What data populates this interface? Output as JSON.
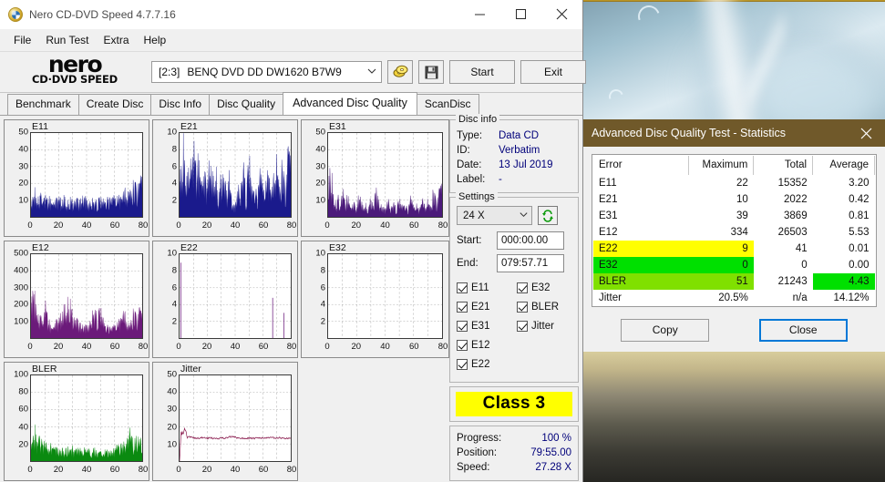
{
  "window": {
    "title": "Nero CD-DVD Speed 4.7.7.16",
    "icon": "nero-disc-icon",
    "minimize": "minimize-icon",
    "maximize": "maximize-icon",
    "close": "close-icon"
  },
  "menu": {
    "items": [
      "File",
      "Run Test",
      "Extra",
      "Help"
    ]
  },
  "toolbar": {
    "logo_word": "nero",
    "logo_sub": "CD·DVD SPEED",
    "drive_bracket": "[2:3]",
    "drive_name": "BENQ DVD DD DW1620 B7W9",
    "speed_icon": "disc-speed-icon",
    "save_icon": "floppy-save-icon",
    "start_label": "Start",
    "exit_label": "Exit"
  },
  "tabs": {
    "items": [
      "Benchmark",
      "Create Disc",
      "Disc Info",
      "Disc Quality",
      "Advanced Disc Quality",
      "ScanDisc"
    ],
    "active": "Advanced Disc Quality"
  },
  "disc_info": {
    "title": "Disc info",
    "rows": [
      {
        "label": "Type:",
        "value": "Data CD"
      },
      {
        "label": "ID:",
        "value": "Verbatim"
      },
      {
        "label": "Date:",
        "value": "13 Jul 2019"
      },
      {
        "label": "Label:",
        "value": "-"
      }
    ]
  },
  "settings": {
    "title": "Settings",
    "speed": "24 X",
    "refresh_icon": "refresh-icon",
    "start_label": "Start:",
    "start_value": "000:00.00",
    "end_label": "End:",
    "end_value": "079:57.71",
    "checkboxes_left": [
      {
        "label": "E11",
        "checked": true
      },
      {
        "label": "E21",
        "checked": true
      },
      {
        "label": "E31",
        "checked": true
      },
      {
        "label": "E12",
        "checked": true
      },
      {
        "label": "E22",
        "checked": true
      }
    ],
    "checkboxes_right": [
      {
        "label": "E32",
        "checked": true
      },
      {
        "label": "BLER",
        "checked": true
      },
      {
        "label": "Jitter",
        "checked": true
      }
    ]
  },
  "class_result": {
    "label": "Class 3",
    "background": "#ffff00"
  },
  "progress": {
    "rows": [
      {
        "label": "Progress:",
        "value": "100 %"
      },
      {
        "label": "Position:",
        "value": "79:55.00"
      },
      {
        "label": "Speed:",
        "value": "27.28 X"
      }
    ]
  },
  "stats_dialog": {
    "title": "Advanced Disc Quality Test - Statistics",
    "titlebar_color": "#70592a",
    "close_icon": "close-icon",
    "columns": [
      "Error",
      "Maximum",
      "Total",
      "Average"
    ],
    "rows": [
      {
        "error": "E11",
        "maximum": "22",
        "total": "15352",
        "average": "3.20",
        "row_highlight": null,
        "avg_highlight": null
      },
      {
        "error": "E21",
        "maximum": "10",
        "total": "2022",
        "average": "0.42",
        "row_highlight": null,
        "avg_highlight": null
      },
      {
        "error": "E31",
        "maximum": "39",
        "total": "3869",
        "average": "0.81",
        "row_highlight": null,
        "avg_highlight": null
      },
      {
        "error": "E12",
        "maximum": "334",
        "total": "26503",
        "average": "5.53",
        "row_highlight": null,
        "avg_highlight": null
      },
      {
        "error": "E22",
        "maximum": "9",
        "total": "41",
        "average": "0.01",
        "row_highlight": "#ffff00",
        "avg_highlight": null
      },
      {
        "error": "E32",
        "maximum": "0",
        "total": "0",
        "average": "0.00",
        "row_highlight": "#00e000",
        "avg_highlight": null
      },
      {
        "error": "BLER",
        "maximum": "51",
        "total": "21243",
        "average": "4.43",
        "row_highlight": "#80e000",
        "avg_highlight": "#00e000"
      },
      {
        "error": "Jitter",
        "maximum": "20.5%",
        "total": "n/a",
        "average": "14.12%",
        "row_highlight": null,
        "avg_highlight": null
      }
    ],
    "copy_label": "Copy",
    "close_label": "Close"
  },
  "chart_data": [
    {
      "type": "area",
      "title": "E11",
      "xlabel": "",
      "ylabel": "",
      "xlim": [
        0,
        80
      ],
      "ylim": [
        0,
        50
      ],
      "xticks": [
        0,
        20,
        40,
        60,
        80
      ],
      "yticks": [
        10,
        20,
        30,
        40,
        50
      ],
      "grid": true,
      "color": "#1a1a8c",
      "x": [
        0,
        1,
        2,
        3,
        4,
        5,
        6,
        7,
        8,
        9,
        10,
        12,
        14,
        16,
        18,
        20,
        22,
        24,
        26,
        28,
        30,
        32,
        34,
        36,
        38,
        40,
        42,
        44,
        46,
        48,
        50,
        52,
        54,
        56,
        58,
        60,
        62,
        64,
        66,
        68,
        70,
        71,
        72,
        73,
        74,
        75,
        76,
        77,
        78,
        79,
        80
      ],
      "values": [
        6,
        14,
        11,
        16,
        9,
        13,
        10,
        15,
        8,
        12,
        14,
        9,
        11,
        8,
        12,
        10,
        9,
        11,
        8,
        10,
        9,
        8,
        11,
        9,
        17,
        8,
        9,
        10,
        8,
        9,
        10,
        9,
        11,
        10,
        9,
        11,
        12,
        13,
        14,
        16,
        18,
        22,
        17,
        20,
        16,
        19,
        17,
        21,
        18,
        22,
        20
      ]
    },
    {
      "type": "area",
      "title": "E21",
      "xlabel": "",
      "ylabel": "",
      "xlim": [
        0,
        80
      ],
      "ylim": [
        0,
        10
      ],
      "xticks": [
        0,
        20,
        40,
        60,
        80
      ],
      "yticks": [
        2,
        4,
        6,
        8,
        10
      ],
      "grid": true,
      "color": "#1a1a8c",
      "x": [
        0,
        1,
        2,
        3,
        4,
        5,
        6,
        7,
        8,
        9,
        10,
        12,
        14,
        16,
        18,
        20,
        22,
        24,
        26,
        28,
        30,
        32,
        34,
        36,
        38,
        40,
        42,
        44,
        46,
        48,
        50,
        52,
        54,
        56,
        58,
        60,
        62,
        64,
        66,
        68,
        70,
        72,
        74,
        76,
        78,
        80
      ],
      "values": [
        4,
        8,
        3,
        10,
        5,
        4,
        8,
        3,
        7,
        6,
        10,
        5,
        7,
        4,
        6,
        3,
        7,
        4,
        6,
        2,
        5,
        4,
        3,
        5,
        2,
        1,
        4,
        3,
        6,
        2,
        7,
        3,
        4,
        2,
        5,
        3,
        4,
        6,
        3,
        5,
        9,
        4,
        6,
        3,
        8,
        6
      ]
    },
    {
      "type": "area",
      "title": "E31",
      "xlabel": "",
      "ylabel": "",
      "xlim": [
        0,
        80
      ],
      "ylim": [
        0,
        50
      ],
      "xticks": [
        0,
        20,
        40,
        60,
        80
      ],
      "yticks": [
        10,
        20,
        30,
        40,
        50
      ],
      "grid": true,
      "color": "#4b1a7a",
      "x": [
        0,
        1,
        2,
        3,
        4,
        5,
        6,
        7,
        8,
        9,
        10,
        12,
        14,
        16,
        18,
        20,
        22,
        24,
        26,
        28,
        30,
        32,
        34,
        36,
        38,
        40,
        42,
        44,
        46,
        48,
        50,
        52,
        54,
        56,
        58,
        60,
        62,
        64,
        66,
        68,
        70,
        72,
        74,
        76,
        78,
        80
      ],
      "values": [
        10,
        39,
        12,
        25,
        8,
        11,
        6,
        14,
        4,
        9,
        19,
        7,
        13,
        5,
        10,
        3,
        15,
        6,
        8,
        4,
        11,
        5,
        18,
        7,
        9,
        3,
        12,
        5,
        8,
        4,
        10,
        6,
        9,
        3,
        11,
        5,
        8,
        4,
        12,
        6,
        13,
        7,
        15,
        9,
        16,
        17
      ]
    },
    {
      "type": "area",
      "title": "E12",
      "xlabel": "",
      "ylabel": "",
      "xlim": [
        0,
        80
      ],
      "ylim": [
        0,
        500
      ],
      "xticks": [
        0,
        20,
        40,
        60,
        80
      ],
      "yticks": [
        100,
        200,
        300,
        400,
        500
      ],
      "grid": true,
      "color": "#6b1a7a",
      "x": [
        0,
        1,
        2,
        3,
        4,
        5,
        6,
        7,
        8,
        9,
        10,
        12,
        14,
        16,
        18,
        20,
        22,
        24,
        26,
        28,
        30,
        32,
        34,
        36,
        38,
        40,
        42,
        44,
        46,
        48,
        50,
        52,
        54,
        56,
        58,
        60,
        62,
        64,
        66,
        68,
        70,
        72,
        74,
        76,
        78,
        80
      ],
      "values": [
        200,
        334,
        260,
        230,
        180,
        150,
        120,
        140,
        100,
        90,
        250,
        110,
        80,
        60,
        120,
        90,
        140,
        170,
        210,
        205,
        130,
        90,
        110,
        70,
        100,
        60,
        90,
        140,
        150,
        120,
        165,
        100,
        80,
        60,
        50,
        70,
        90,
        120,
        160,
        140,
        100,
        120,
        150,
        130,
        175,
        120
      ]
    },
    {
      "type": "bar",
      "title": "E22",
      "xlabel": "",
      "ylabel": "",
      "xlim": [
        0,
        80
      ],
      "ylim": [
        0,
        10
      ],
      "xticks": [
        0,
        20,
        40,
        60,
        80
      ],
      "yticks": [
        2,
        4,
        6,
        8,
        10
      ],
      "grid": true,
      "color": "#6b1a7a",
      "x": [
        1,
        67,
        75
      ],
      "values": [
        9,
        4.8,
        3
      ]
    },
    {
      "type": "bar",
      "title": "E32",
      "xlabel": "",
      "ylabel": "",
      "xlim": [
        0,
        80
      ],
      "ylim": [
        0,
        10
      ],
      "xticks": [
        0,
        20,
        40,
        60,
        80
      ],
      "yticks": [
        2,
        4,
        6,
        8,
        10
      ],
      "grid": true,
      "color": "#6b1a7a",
      "x": [],
      "values": []
    },
    {
      "type": "area",
      "title": "BLER",
      "xlabel": "",
      "ylabel": "",
      "xlim": [
        0,
        80
      ],
      "ylim": [
        0,
        100
      ],
      "xticks": [
        0,
        20,
        40,
        60,
        80
      ],
      "yticks": [
        20,
        40,
        60,
        80,
        100
      ],
      "grid": true,
      "color": "#0a8a10",
      "x": [
        0,
        1,
        2,
        3,
        4,
        5,
        6,
        7,
        8,
        9,
        10,
        12,
        14,
        16,
        18,
        20,
        22,
        24,
        26,
        28,
        30,
        32,
        34,
        36,
        38,
        40,
        42,
        44,
        46,
        48,
        50,
        52,
        54,
        56,
        58,
        60,
        62,
        64,
        66,
        68,
        70,
        71,
        72,
        73,
        74,
        75,
        76,
        77,
        78,
        79,
        80
      ],
      "values": [
        12,
        30,
        22,
        51,
        20,
        26,
        47,
        18,
        24,
        16,
        22,
        14,
        20,
        13,
        18,
        12,
        17,
        13,
        16,
        11,
        15,
        12,
        16,
        11,
        14,
        10,
        13,
        11,
        15,
        10,
        12,
        9,
        13,
        10,
        12,
        14,
        16,
        18,
        20,
        24,
        30,
        33,
        26,
        28,
        22,
        30,
        24,
        28,
        25,
        31,
        28
      ]
    },
    {
      "type": "line",
      "title": "Jitter",
      "xlabel": "",
      "ylabel": "",
      "xlim": [
        0,
        80
      ],
      "ylim": [
        0,
        50
      ],
      "xticks": [
        0,
        20,
        40,
        60,
        80
      ],
      "yticks": [
        10,
        20,
        30,
        40,
        50
      ],
      "grid": true,
      "color": "#8a1b4e",
      "x": [
        0,
        1,
        2,
        3,
        4,
        5,
        6,
        7,
        8,
        9,
        10,
        12,
        14,
        16,
        18,
        20,
        22,
        24,
        26,
        28,
        30,
        32,
        34,
        36,
        38,
        40,
        42,
        44,
        46,
        48,
        50,
        52,
        54,
        56,
        58,
        60,
        62,
        64,
        66,
        68,
        70,
        72,
        74,
        76,
        78,
        80
      ],
      "values": [
        0,
        17,
        16,
        15.5,
        19,
        15,
        14.5,
        14,
        14,
        13.8,
        13.6,
        13.5,
        13.4,
        13.6,
        13.4,
        13.3,
        13.5,
        13.3,
        13.4,
        13.2,
        13.5,
        13.3,
        13.6,
        14,
        14.2,
        13.8,
        13.5,
        13.4,
        13.3,
        13.2,
        13.4,
        13.3,
        13.2,
        13.4,
        13.5,
        13.3,
        13.6,
        13.4,
        13.8,
        13.5,
        13.3,
        13.6,
        13.4,
        13.2,
        13.3,
        13.2
      ]
    }
  ]
}
